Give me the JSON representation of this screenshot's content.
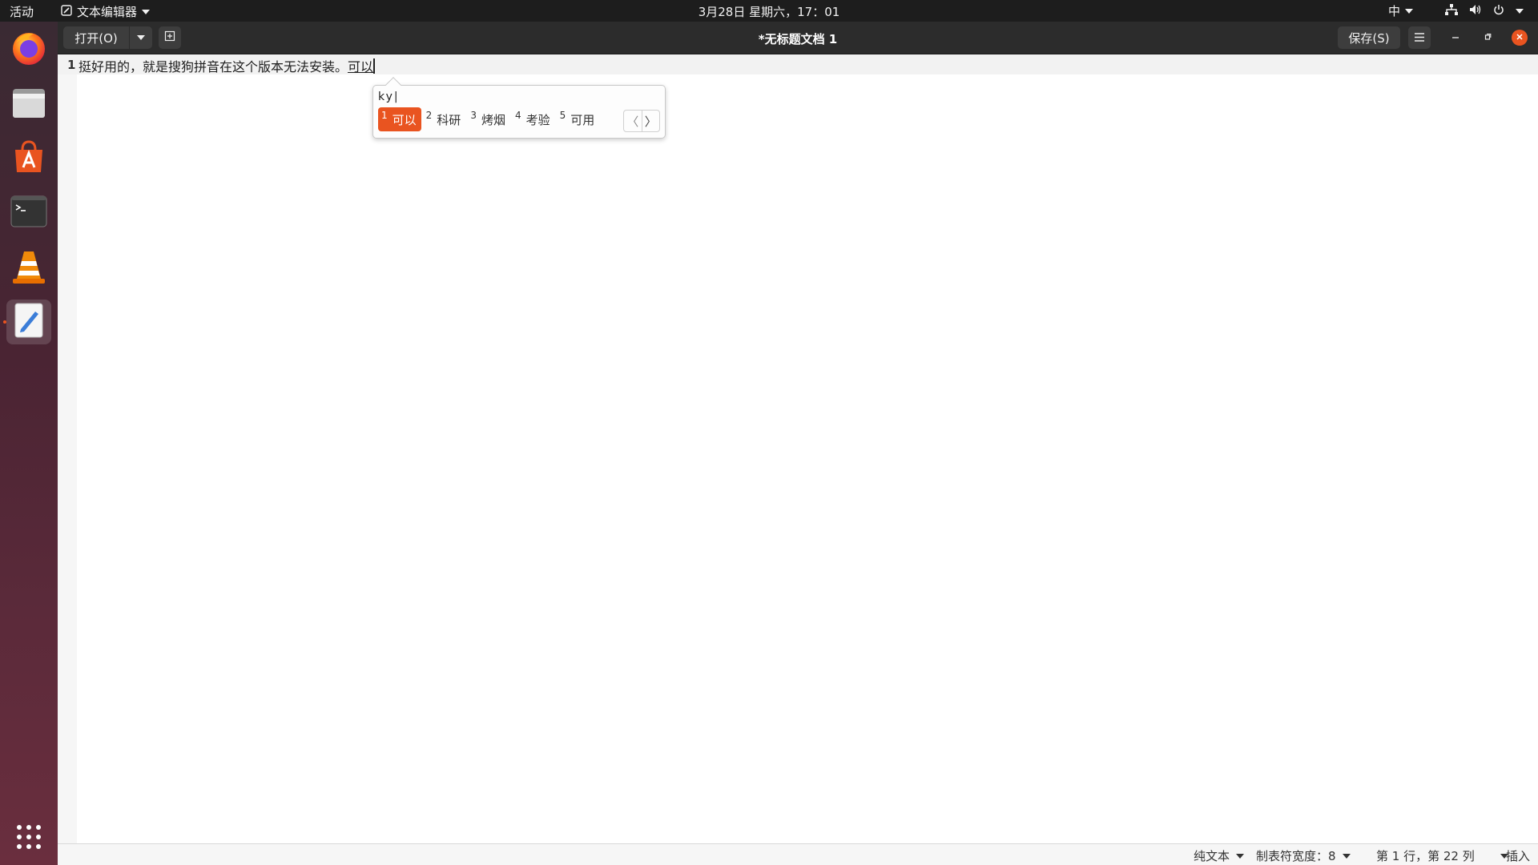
{
  "topbar": {
    "activities": "活动",
    "app_name": "文本编辑器",
    "clock": "3月28日 星期六，17：01",
    "input_method": "中"
  },
  "dock": {
    "items": [
      "firefox-icon",
      "files-icon",
      "software-icon",
      "terminal-icon",
      "vlc-icon",
      "text-editor-icon"
    ],
    "show_apps": "show-applications-icon"
  },
  "window": {
    "title": "*无标题文档 1",
    "open_label": "打开(O)",
    "save_label": "保存(S)"
  },
  "editor": {
    "line_number": "1",
    "line_text": "挺好用的，就是搜狗拼音在这个版本无法安装。",
    "preedit_text": "可以"
  },
  "ime": {
    "input": "ky|",
    "candidates": [
      {
        "num": "1",
        "text": "可以"
      },
      {
        "num": "2",
        "text": "科研"
      },
      {
        "num": "3",
        "text": "烤烟"
      },
      {
        "num": "4",
        "text": "考验"
      },
      {
        "num": "5",
        "text": "可用"
      }
    ],
    "prev": "〈",
    "next": "〉"
  },
  "statusbar": {
    "language": "纯文本",
    "tab_width": "制表符宽度：8",
    "position": "第 1 行，第 22 列",
    "mode": "插入"
  },
  "colors": {
    "accent": "#e95420",
    "topbar": "#1d1d1d",
    "headerbar": "#2c2c2c"
  }
}
